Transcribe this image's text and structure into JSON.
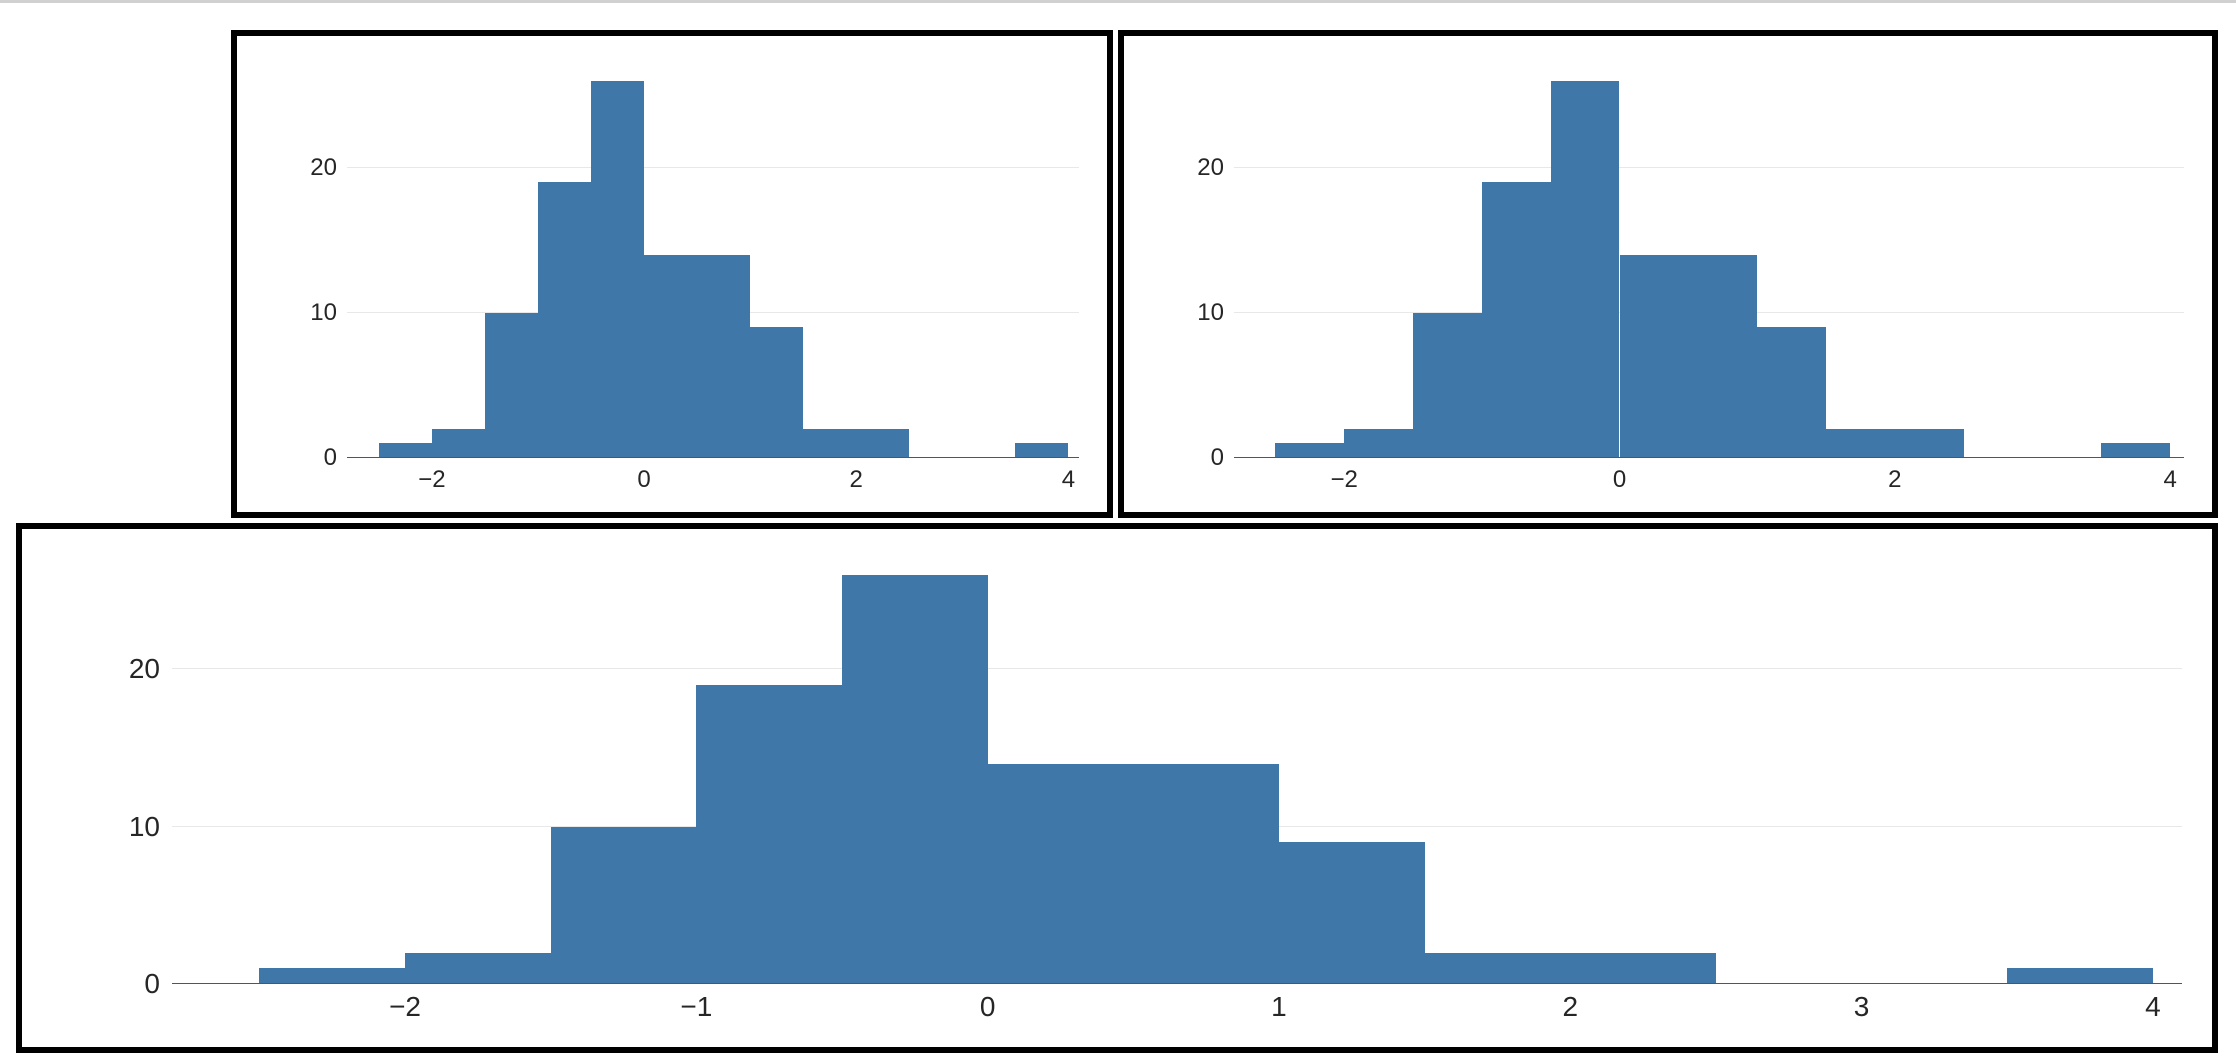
{
  "chart_data": [
    {
      "id": "top-left",
      "type": "histogram",
      "bin_width": 0.5,
      "bins": [
        {
          "start": -2.5,
          "end": -2.0,
          "count": 1
        },
        {
          "start": -2.0,
          "end": -1.5,
          "count": 2
        },
        {
          "start": -1.5,
          "end": -1.0,
          "count": 10
        },
        {
          "start": -1.0,
          "end": -0.5,
          "count": 19
        },
        {
          "start": -0.5,
          "end": 0.0,
          "count": 26
        },
        {
          "start": 0.0,
          "end": 0.5,
          "count": 14
        },
        {
          "start": 0.5,
          "end": 1.0,
          "count": 14
        },
        {
          "start": 1.0,
          "end": 1.5,
          "count": 9
        },
        {
          "start": 1.5,
          "end": 2.0,
          "count": 2
        },
        {
          "start": 2.0,
          "end": 2.5,
          "count": 2
        },
        {
          "start": 3.5,
          "end": 4.0,
          "count": 1
        }
      ],
      "xlim": [
        -2.8,
        4.1
      ],
      "ylim": [
        0,
        27
      ],
      "y_ticks": [
        0,
        10,
        20
      ],
      "x_ticks": [
        -2,
        0,
        2,
        4
      ]
    },
    {
      "id": "top-right",
      "type": "histogram",
      "bin_width": 0.5,
      "bins": [
        {
          "start": -2.5,
          "end": -2.0,
          "count": 1
        },
        {
          "start": -2.0,
          "end": -1.5,
          "count": 2
        },
        {
          "start": -1.5,
          "end": -1.0,
          "count": 10
        },
        {
          "start": -1.0,
          "end": -0.5,
          "count": 19
        },
        {
          "start": -0.5,
          "end": 0.0,
          "count": 26
        },
        {
          "start": 0.0,
          "end": 0.5,
          "count": 14
        },
        {
          "start": 0.5,
          "end": 1.0,
          "count": 14
        },
        {
          "start": 1.0,
          "end": 1.5,
          "count": 9
        },
        {
          "start": 1.5,
          "end": 2.0,
          "count": 2
        },
        {
          "start": 2.0,
          "end": 2.5,
          "count": 2
        },
        {
          "start": 3.5,
          "end": 4.0,
          "count": 1
        }
      ],
      "xlim": [
        -2.8,
        4.1
      ],
      "ylim": [
        0,
        27
      ],
      "y_ticks": [
        0,
        10,
        20
      ],
      "x_ticks": [
        -2,
        0,
        2,
        4
      ]
    },
    {
      "id": "bottom",
      "type": "histogram",
      "bin_width": 0.5,
      "bins": [
        {
          "start": -2.5,
          "end": -2.0,
          "count": 1
        },
        {
          "start": -2.0,
          "end": -1.5,
          "count": 2
        },
        {
          "start": -1.5,
          "end": -1.0,
          "count": 10
        },
        {
          "start": -1.0,
          "end": -0.5,
          "count": 19
        },
        {
          "start": -0.5,
          "end": 0.0,
          "count": 26
        },
        {
          "start": 0.0,
          "end": 0.5,
          "count": 14
        },
        {
          "start": 0.5,
          "end": 1.0,
          "count": 14
        },
        {
          "start": 1.0,
          "end": 1.5,
          "count": 9
        },
        {
          "start": 1.5,
          "end": 2.0,
          "count": 2
        },
        {
          "start": 2.0,
          "end": 2.5,
          "count": 2
        },
        {
          "start": 3.5,
          "end": 4.0,
          "count": 1
        }
      ],
      "xlim": [
        -2.8,
        4.1
      ],
      "ylim": [
        0,
        27
      ],
      "y_ticks": [
        0,
        10,
        20
      ],
      "x_ticks": [
        -2,
        -1,
        0,
        1,
        2,
        3,
        4
      ]
    }
  ],
  "colors": {
    "bar": "#3f78a8"
  }
}
